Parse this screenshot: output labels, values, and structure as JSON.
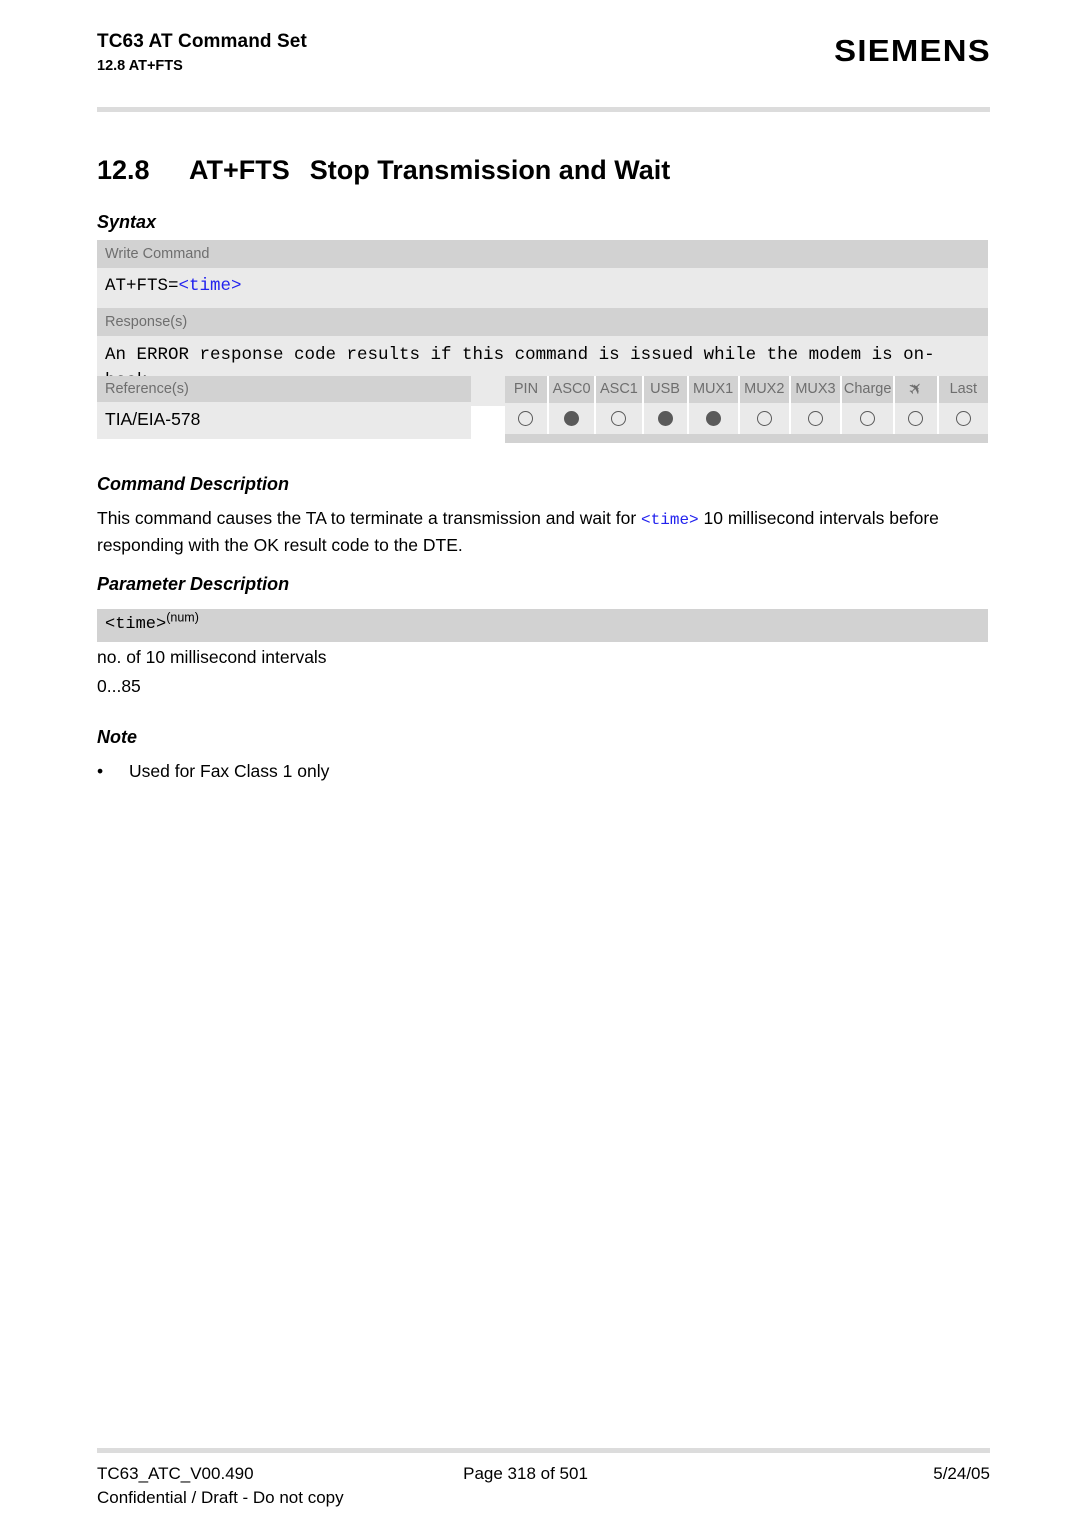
{
  "header": {
    "doc_title": "TC63 AT Command Set",
    "doc_subtitle": "12.8 AT+FTS",
    "brand": "SIEMENS"
  },
  "section": {
    "number": "12.8",
    "command": "AT+FTS",
    "title": "Stop Transmission and Wait"
  },
  "headings": {
    "syntax": "Syntax",
    "command_description": "Command Description",
    "parameter_description": "Parameter Description",
    "note": "Note"
  },
  "syntax": {
    "write_command_label": "Write Command",
    "write_command_code_prefix": "AT+FTS=",
    "write_command_code_param": "<time>",
    "responses_label": "Response(s)",
    "responses_code": "An ERROR response code results if this command is issued while the modem is on-hook."
  },
  "references": {
    "label": "Reference(s)",
    "value": "TIA/EIA-578"
  },
  "indicators": {
    "columns": [
      {
        "label": "PIN",
        "state": "empty"
      },
      {
        "label": "ASC0",
        "state": "filled"
      },
      {
        "label": "ASC1",
        "state": "empty"
      },
      {
        "label": "USB",
        "state": "filled"
      },
      {
        "label": "MUX1",
        "state": "filled"
      },
      {
        "label": "MUX2",
        "state": "empty"
      },
      {
        "label": "MUX3",
        "state": "empty"
      },
      {
        "label": "Charge",
        "state": "empty"
      },
      {
        "label": "airplane-icon",
        "state": "empty"
      },
      {
        "label": "Last",
        "state": "empty"
      }
    ],
    "airplane_glyph": "✈"
  },
  "command_description": {
    "text_part1": "This command causes the TA to terminate a transmission and wait for ",
    "param": "<time>",
    "text_part2": " 10 millisecond intervals before responding with the OK result code to the DTE."
  },
  "parameter_description": {
    "name": "<time>",
    "superscript": "(num)",
    "text": "no. of 10 millisecond intervals",
    "range": "0...85"
  },
  "note": {
    "bullet": "•",
    "text": "Used for Fax Class 1 only"
  },
  "footer": {
    "doc_id": "TC63_ATC_V00.490",
    "page": "Page 318 of 501",
    "date": "5/24/05",
    "confidential": "Confidential / Draft - Do not copy"
  },
  "colors": {
    "param_link": "#2222ee",
    "band_dark": "#d2d2d2",
    "band_light": "#eaeaea",
    "rule": "#dcdcdc"
  }
}
